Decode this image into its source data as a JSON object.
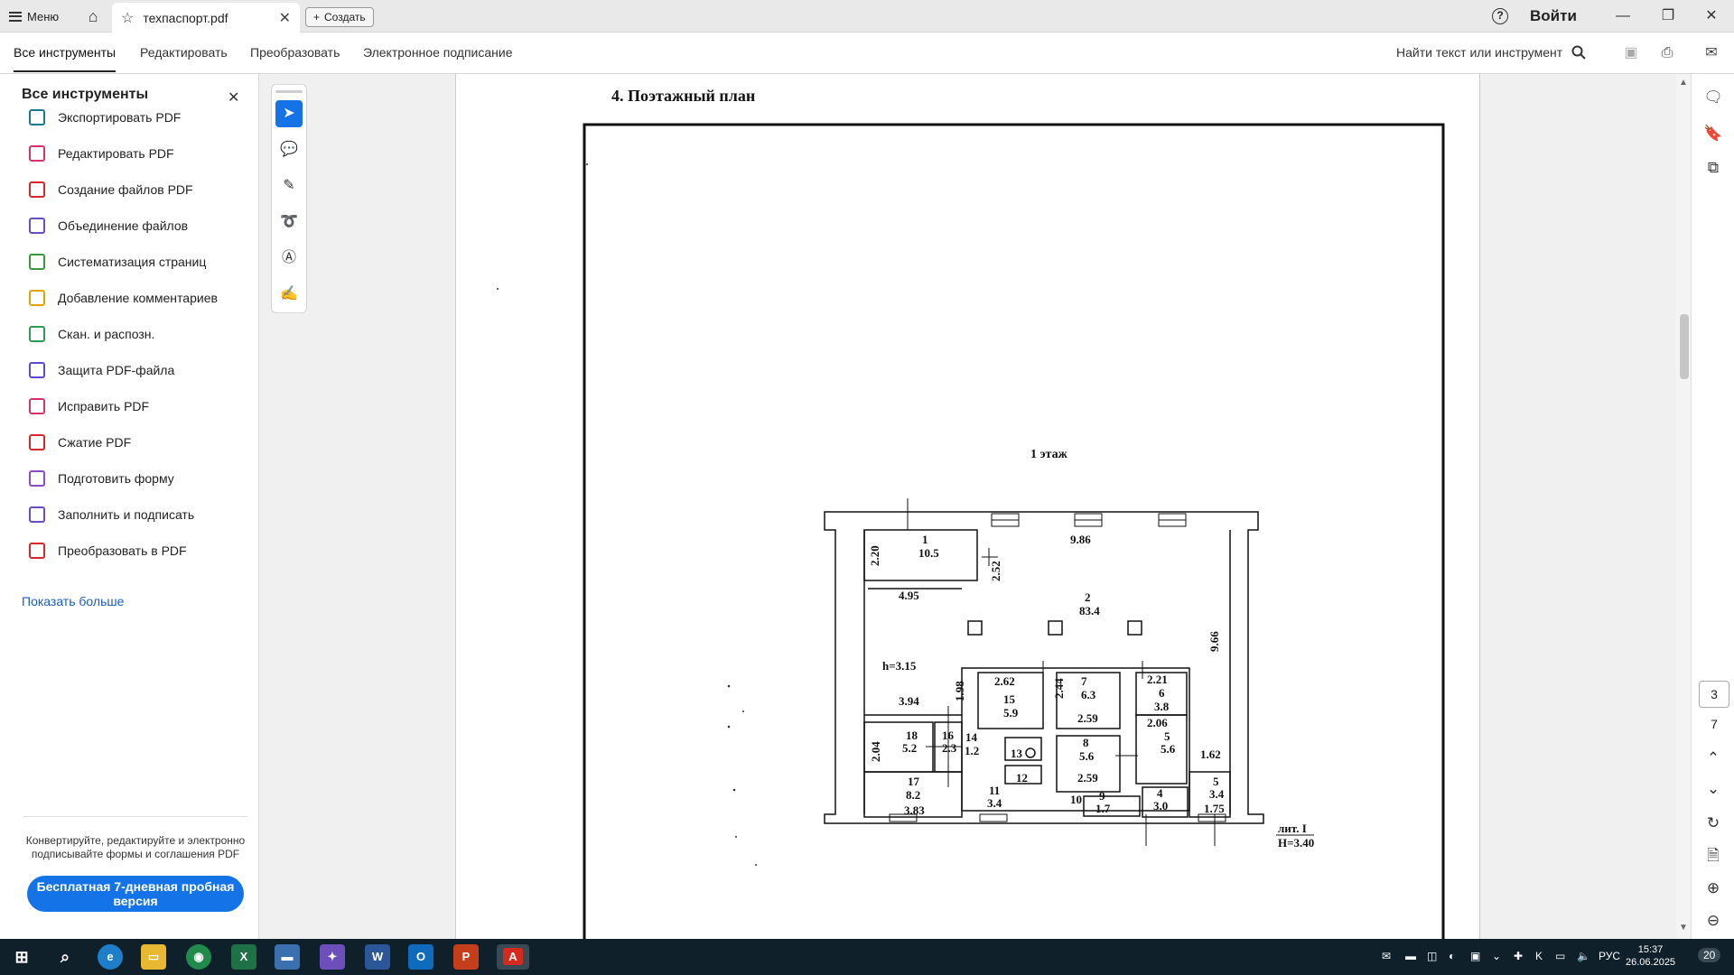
{
  "titlebar": {
    "menu_label": "Меню",
    "tab_title": "техпаспорт.pdf",
    "create_label": "Создать",
    "signin_label": "Войти"
  },
  "toolbar": {
    "tabs": [
      "Все инструменты",
      "Редактировать",
      "Преобразовать",
      "Электронное подписание"
    ],
    "find_label": "Найти текст или инструмент"
  },
  "left_panel": {
    "title": "Все инструменты",
    "tools": [
      {
        "label": "Экспортировать PDF",
        "color": "#1a7a8a"
      },
      {
        "label": "Редактировать PDF",
        "color": "#d6336c"
      },
      {
        "label": "Создание файлов PDF",
        "color": "#d62828"
      },
      {
        "label": "Объединение файлов",
        "color": "#6a4cc7"
      },
      {
        "label": "Систематизация страниц",
        "color": "#3a9a3a"
      },
      {
        "label": "Добавление комментариев",
        "color": "#e0a400"
      },
      {
        "label": "Скан. и распозн.",
        "color": "#2e9b55"
      },
      {
        "label": "Защита PDF-файла",
        "color": "#5a4cd0"
      },
      {
        "label": "Исправить PDF",
        "color": "#d6336c"
      },
      {
        "label": "Сжатие PDF",
        "color": "#d62828"
      },
      {
        "label": "Подготовить форму",
        "color": "#8a4cc7"
      },
      {
        "label": "Заполнить и подписать",
        "color": "#6a4cc7"
      },
      {
        "label": "Преобразовать в PDF",
        "color": "#d62828"
      }
    ],
    "show_more": "Показать больше",
    "promo_text": "Конвертируйте, редактируйте и электронно подписывайте формы и соглашения PDF",
    "trial_button": "Бесплатная 7-дневная пробная версия"
  },
  "document": {
    "section_heading": "4.    Поэтажный план",
    "floor_label": "1 этаж",
    "plan_labels": [
      "1",
      "10.5",
      "2.20",
      "2.52",
      "9.86",
      "4.95",
      "2",
      "83.4",
      "9.66",
      "h=3.15",
      "2.62",
      "15",
      "5.9",
      "7",
      "6.3",
      "2.44",
      "2.59",
      "2.21",
      "6",
      "3.8",
      "3.94",
      "1.98",
      "2.06",
      "18",
      "5.2",
      "2.04",
      "16",
      "2.3",
      "14",
      "1.2",
      "13",
      "8",
      "5.6",
      "2.59",
      "5",
      "5.6",
      "1.62",
      "12",
      "17",
      "8.2",
      "3.83",
      "11",
      "3.4",
      "10",
      "9",
      "1.7",
      "4",
      "3.0",
      "5",
      "3.4",
      "1.75"
    ],
    "lit_label": "лит. I",
    "height_label": "H=3.40"
  },
  "right_rail": {
    "current_page": "3",
    "total_pages": "7"
  },
  "taskbar": {
    "tray_lang": "РУС",
    "time": "15:37",
    "date": "26.06.2025",
    "notifications": "20"
  }
}
